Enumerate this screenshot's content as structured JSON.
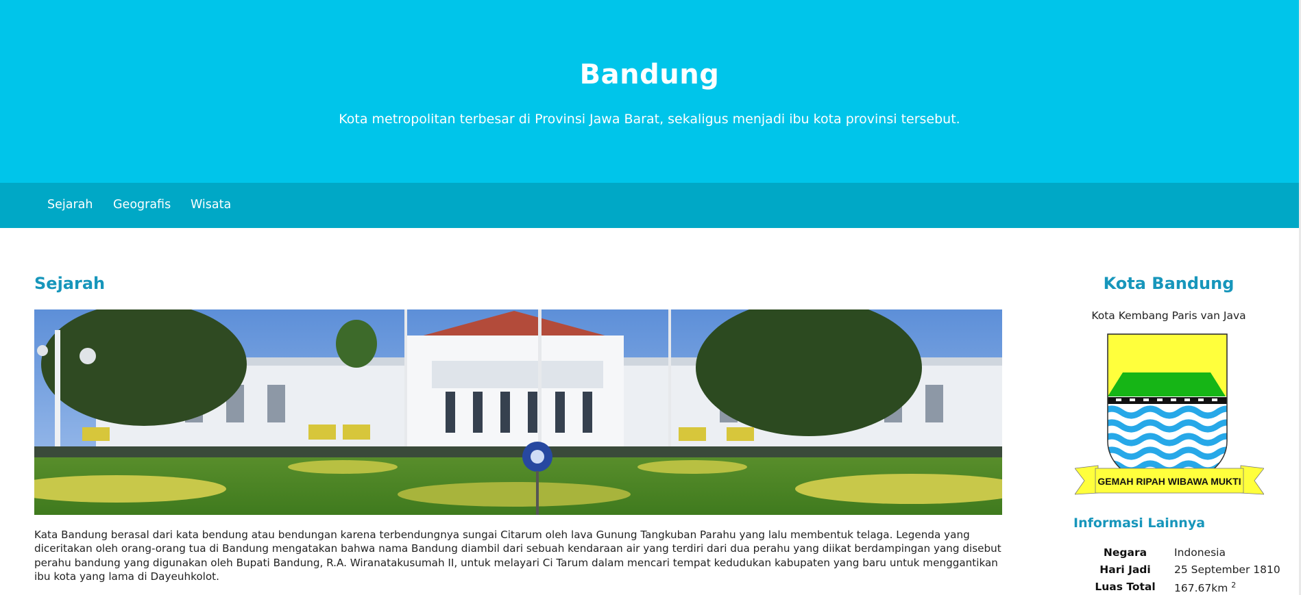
{
  "hero": {
    "title": "Bandung",
    "subtitle": "Kota metropolitan terbesar di Provinsi Jawa Barat, sekaligus menjadi ibu kota provinsi tersebut."
  },
  "nav": {
    "items": [
      {
        "label": "Sejarah"
      },
      {
        "label": "Geografis"
      },
      {
        "label": "Wisata"
      }
    ]
  },
  "main": {
    "section_title": "Sejarah",
    "image_subject": "gedung-sate-building-photo",
    "paragraph": "Kata Bandung berasal dari kata bendung atau bendungan karena terbendungnya sungai Citarum oleh lava Gunung Tangkuban Parahu yang lalu membentuk telaga. Legenda yang diceritakan oleh orang-orang tua di Bandung mengatakan bahwa nama Bandung diambil dari sebuah kendaraan air yang terdiri dari dua perahu yang diikat berdampingan yang disebut perahu bandung yang digunakan oleh Bupati Bandung, R.A. Wiranatakusumah II, untuk melayari Ci Tarum dalam mencari tempat kedudukan kabupaten yang baru untuk menggantikan ibu kota yang lama di Dayeuhkolot."
  },
  "aside": {
    "title": "Kota Bandung",
    "tagline": "Kota Kembang Paris van Java",
    "emblem_motto": "GEMAH RIPAH WIBAWA MUKTI",
    "info_title": "Informasi Lainnya",
    "info_rows": [
      {
        "key": "Negara",
        "value": "Indonesia",
        "sup": ""
      },
      {
        "key": "Hari Jadi",
        "value": "25 September 1810",
        "sup": ""
      },
      {
        "key": "Luas Total",
        "value": "167.67km",
        "sup": "2"
      }
    ]
  },
  "colors": {
    "hero_bg": "#00c5ea",
    "nav_bg": "#00a8c6",
    "heading": "#1796bb",
    "emblem_yellow": "#ffff3c",
    "emblem_green": "#16b516",
    "emblem_blue": "#27a8e8"
  }
}
